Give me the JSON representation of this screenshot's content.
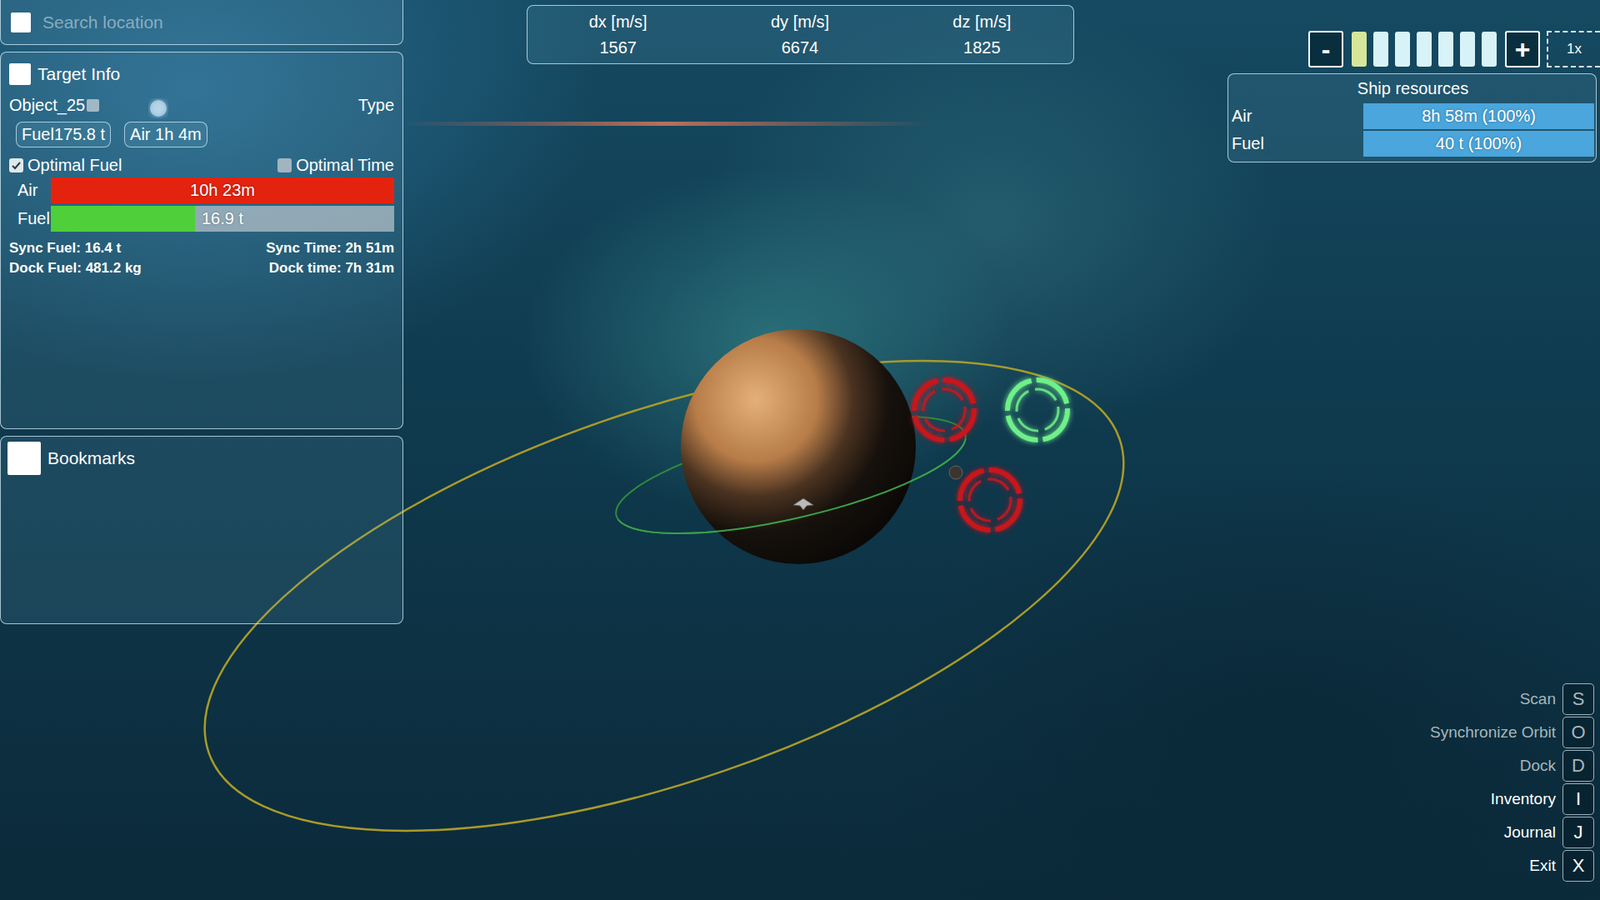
{
  "search": {
    "placeholder": "Search location"
  },
  "target_info": {
    "title": "Target Info",
    "object": "Object_25",
    "object_checked": false,
    "type_label": "Type",
    "badges": [
      "Fuel175.8 t",
      "Air 1h 4m"
    ],
    "options": [
      {
        "label": "Optimal Fuel",
        "checked": true
      },
      {
        "label": "Optimal Time",
        "checked": false
      }
    ],
    "bars": [
      {
        "label": "Air",
        "value": "10h 23m",
        "level": 1,
        "color": "#e4230f"
      },
      {
        "label": "Fuel",
        "value": "16.9 t",
        "level": 0.42,
        "color": "#4fcf3a"
      }
    ],
    "stats": [
      {
        "label": "Sync Fuel:",
        "value": "16.4 t"
      },
      {
        "label": "Sync Time:",
        "value": "2h 51m"
      },
      {
        "label": "Dock Fuel:",
        "value": "481.2 kg"
      },
      {
        "label": "Dock time:",
        "value": "7h 31m"
      }
    ]
  },
  "bookmarks": {
    "title": "Bookmarks"
  },
  "velocity": [
    {
      "label": "dx [m/s]",
      "value": "1567"
    },
    {
      "label": "dy [m/s]",
      "value": "6674"
    },
    {
      "label": "dz [m/s]",
      "value": "1825"
    }
  ],
  "time_control": {
    "minus": "-",
    "plus": "+",
    "speed": "1x",
    "segments": [
      {
        "active": true
      },
      {
        "active": false
      },
      {
        "active": false
      },
      {
        "active": false
      },
      {
        "active": false
      },
      {
        "active": false
      },
      {
        "active": false
      }
    ]
  },
  "ship_resources": {
    "title": "Ship resources",
    "items": [
      {
        "label": "Air",
        "value": "8h 58m (100%)",
        "level": 1
      },
      {
        "label": "Fuel",
        "value": "40 t (100%)",
        "level": 1
      }
    ]
  },
  "actions": [
    {
      "label": "Scan",
      "key": "S",
      "enabled": false
    },
    {
      "label": "Synchronize Orbit",
      "key": "O",
      "enabled": false
    },
    {
      "label": "Dock",
      "key": "D",
      "enabled": false
    },
    {
      "label": "Inventory",
      "key": "I",
      "enabled": true
    },
    {
      "label": "Journal",
      "key": "J",
      "enabled": true
    },
    {
      "label": "Exit",
      "key": "X",
      "enabled": true
    }
  ],
  "scene": {
    "markers": [
      {
        "color": "#c8141e"
      },
      {
        "color": "#c8141e"
      },
      {
        "color": "#6ef08a"
      }
    ]
  }
}
